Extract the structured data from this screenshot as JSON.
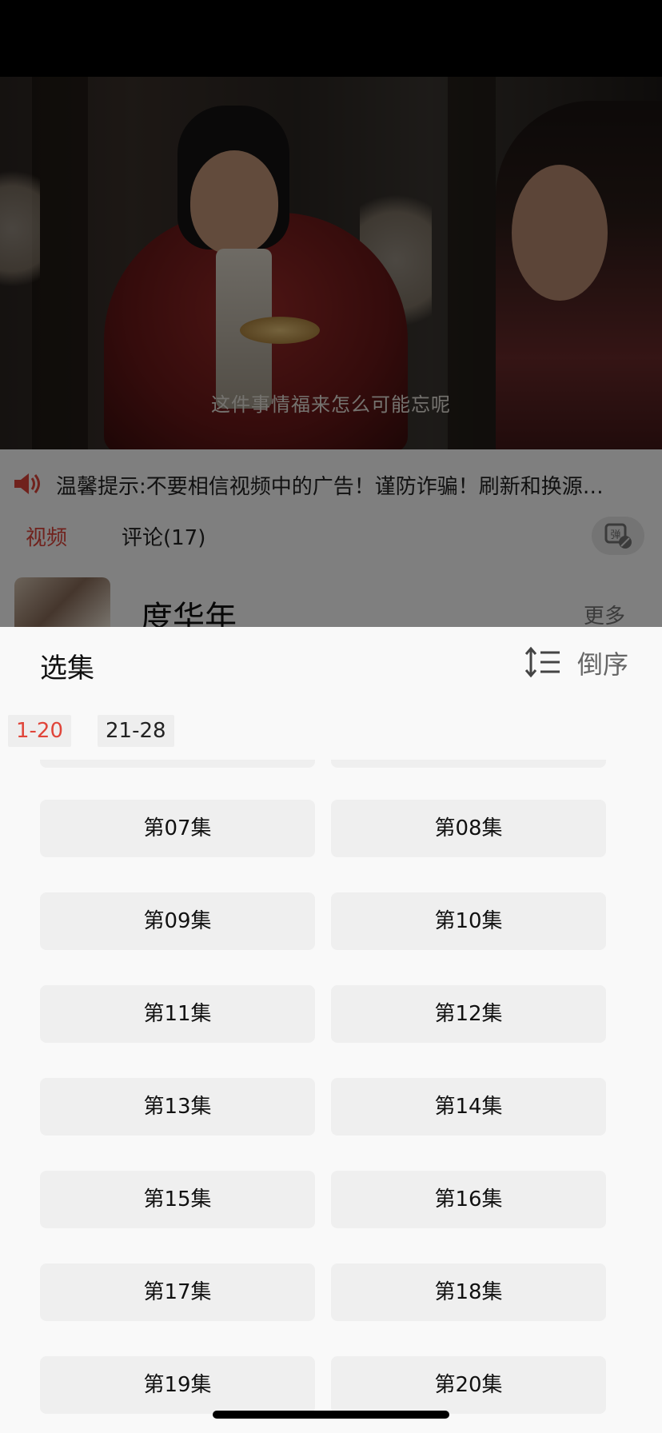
{
  "video": {
    "subtitle": "这件事情福来怎么可能忘呢"
  },
  "notice": {
    "icon": "speaker-icon",
    "text": "温馨提示:不要相信视频中的广告！谨防诈骗！刷新和换源…"
  },
  "tabs": [
    {
      "label": "视频",
      "active": true
    },
    {
      "label": "评论(17)",
      "active": false
    }
  ],
  "danmaku_icon": "danmaku-off-icon",
  "show": {
    "title": "度华年",
    "more_label": "更多"
  },
  "episode_sheet": {
    "title": "选集",
    "sort_label": "倒序",
    "ranges": [
      {
        "label": "1-20",
        "active": true
      },
      {
        "label": "21-28",
        "active": false
      }
    ],
    "episodes": [
      "第07集",
      "第08集",
      "第09集",
      "第10集",
      "第11集",
      "第12集",
      "第13集",
      "第14集",
      "第15集",
      "第16集",
      "第17集",
      "第18集",
      "第19集",
      "第20集"
    ]
  },
  "colors": {
    "accent": "#e0453a",
    "sheet_bg": "#f9f9f9",
    "button_bg": "#efefef"
  }
}
